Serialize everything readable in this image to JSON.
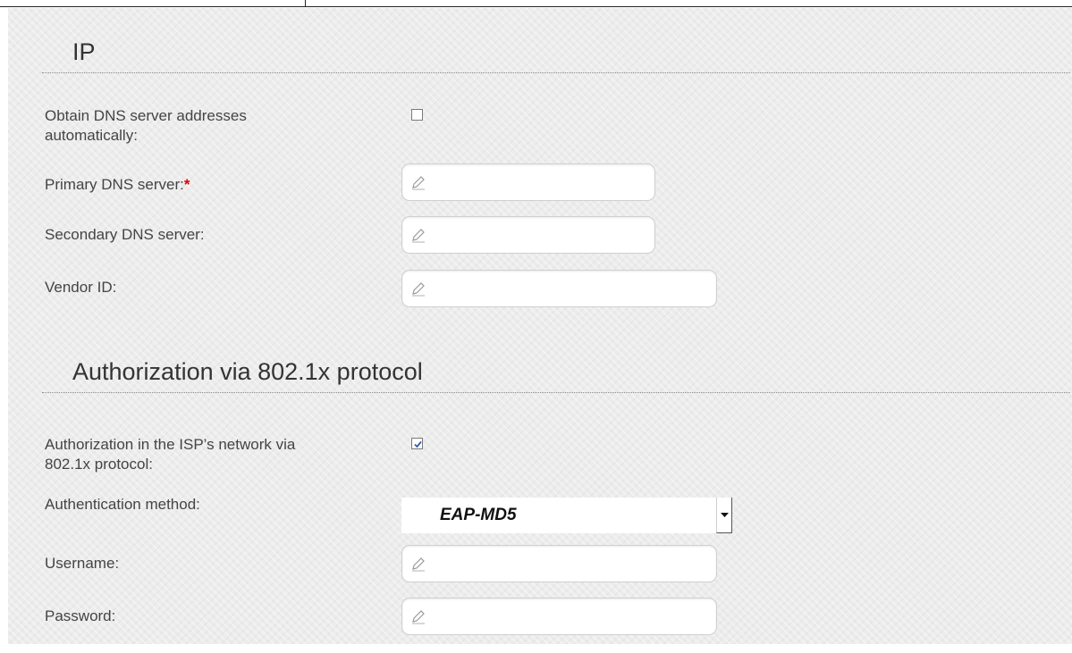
{
  "sections": {
    "ip": {
      "title": "IP"
    },
    "auth": {
      "title": "Authorization via 802.1x protocol"
    }
  },
  "ip": {
    "obtain_dns_label_line1": "Obtain DNS server addresses",
    "obtain_dns_label_line2": "automatically:",
    "obtain_dns_checked": false,
    "primary_dns_label": "Primary DNS server:",
    "primary_dns_required_mark": "*",
    "primary_dns_value": "",
    "secondary_dns_label": "Secondary DNS server:",
    "secondary_dns_value": "",
    "vendor_id_label": "Vendor ID:",
    "vendor_id_value": ""
  },
  "auth": {
    "enable_label_line1": "Authorization in the ISP’s network via",
    "enable_label_line2": "802.1x protocol:",
    "enable_checked": true,
    "method_label": "Authentication method:",
    "method_value": "EAP-MD5",
    "username_label": "Username:",
    "username_value": "",
    "password_label": "Password:",
    "password_value": ""
  },
  "icons": {
    "field_icon": "pencil-icon",
    "dropdown_icon": "chevron-down-icon"
  },
  "colors": {
    "required": "#e00000",
    "checkbox_check": "#3a5aa8"
  }
}
